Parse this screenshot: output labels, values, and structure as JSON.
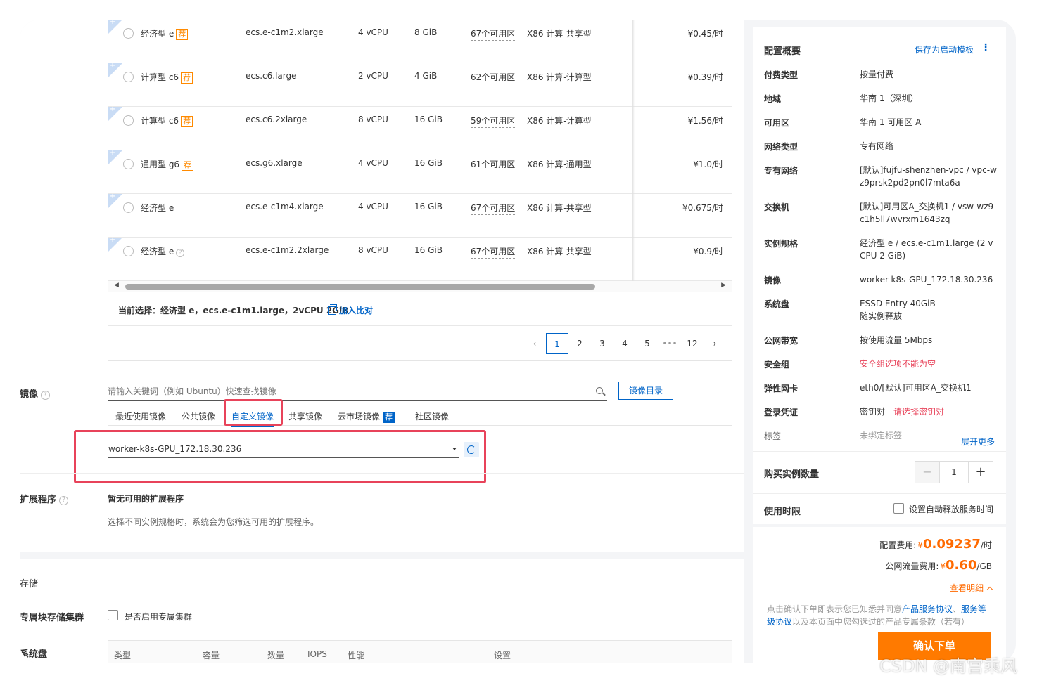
{
  "spec_rows": [
    {
      "family": "经济型 e",
      "badge": "荐",
      "code": "ecs.e-c1m2.xlarge",
      "vcpu": "4 vCPU",
      "mem": "8 GiB",
      "zones": "67个可用区",
      "arch": "X86 计算-共享型",
      "price": "¥0.45",
      "unit": "/时"
    },
    {
      "family": "计算型 c6",
      "badge": "荐",
      "code": "ecs.c6.large",
      "vcpu": "2 vCPU",
      "mem": "4 GiB",
      "zones": "62个可用区",
      "arch": "X86 计算-计算型",
      "price": "¥0.39",
      "unit": "/时"
    },
    {
      "family": "计算型 c6",
      "badge": "荐",
      "code": "ecs.c6.2xlarge",
      "vcpu": "8 vCPU",
      "mem": "16 GiB",
      "zones": "59个可用区",
      "arch": "X86 计算-计算型",
      "price": "¥1.56",
      "unit": "/时"
    },
    {
      "family": "通用型 g6",
      "badge": "荐",
      "code": "ecs.g6.xlarge",
      "vcpu": "4 vCPU",
      "mem": "16 GiB",
      "zones": "61个可用区",
      "arch": "X86 计算-通用型",
      "price": "¥1.0",
      "unit": "/时"
    },
    {
      "family": "经济型 e",
      "badge": "",
      "code": "ecs.e-c1m4.xlarge",
      "vcpu": "4 vCPU",
      "mem": "16 GiB",
      "zones": "67个可用区",
      "arch": "X86 计算-共享型",
      "price": "¥0.675",
      "unit": "/时"
    },
    {
      "family": "经济型 e",
      "badge": "",
      "code": "ecs.e-c1m2.2xlarge",
      "vcpu": "8 vCPU",
      "mem": "16 GiB",
      "zones": "67个可用区",
      "arch": "X86 计算-共享型",
      "price": "¥0.9",
      "unit": "/时"
    }
  ],
  "selection": {
    "label": "当前选择：",
    "value": "经济型 e，ecs.e-c1m1.large，2vCPU 2GiB",
    "compare": "加入比对"
  },
  "pagination": {
    "prev": "‹",
    "pages": [
      "1",
      "2",
      "3",
      "4",
      "5"
    ],
    "ellipsis": "•••",
    "last": "12",
    "next": "›"
  },
  "image": {
    "label": "镜像",
    "search_placeholder": "请输入关键词（例如 Ubuntu）快速查找镜像",
    "catalog_button": "镜像目录",
    "tabs": [
      "最近使用镜像",
      "公共镜像",
      "自定义镜像",
      "共享镜像",
      "云市场镜像",
      "社区镜像"
    ],
    "market_badge": "荐",
    "selected": "worker-k8s-GPU_172.18.30.236"
  },
  "extension": {
    "label": "扩展程序",
    "title": "暂无可用的扩展程序",
    "desc": "选择不同实例规格时，系统会为您筛选可用的扩展程序。"
  },
  "storage": {
    "label": "存储",
    "dedicated_cluster_label": "专属块存储集群",
    "dedicated_cluster_checkbox": "是否启用专属集群",
    "system_disk_label": "系统盘",
    "columns": [
      "类型",
      "容量",
      "数量",
      "IOPS",
      "性能",
      "设置"
    ]
  },
  "summary": {
    "title": "配置概要",
    "save_template": "保存为启动模板",
    "items": [
      {
        "key": "付费类型",
        "value": "按量付费"
      },
      {
        "key": "地域",
        "value": "华南 1（深圳）"
      },
      {
        "key": "可用区",
        "value": "华南 1 可用区 A"
      },
      {
        "key": "网络类型",
        "value": "专有网络"
      },
      {
        "key": "专有网络",
        "value": "[默认]fujfu-shenzhen-vpc / vpc-wz9prsk2pd2pn0l7mta6a"
      },
      {
        "key": "交换机",
        "value": "[默认]可用区A_交换机1 / vsw-wz9c1h5ll7wvrxm1643zq"
      },
      {
        "key": "实例规格",
        "value": "经济型 e / ecs.e-c1m1.large (2 vCPU 2 GiB)"
      },
      {
        "key": "镜像",
        "value": "worker-k8s-GPU_172.18.30.236"
      },
      {
        "key": "系统盘",
        "value": "ESSD Entry 40GiB",
        "value2": "随实例释放"
      },
      {
        "key": "公网带宽",
        "value": "按使用流量 5Mbps"
      },
      {
        "key": "安全组",
        "value": "安全组选项不能为空"
      },
      {
        "key": "弹性网卡",
        "value": "eth0/[默认]可用区A_交换机1"
      },
      {
        "key": "登录凭证",
        "value": "密钥对 - ",
        "link": "请选择密钥对"
      },
      {
        "key": "标签",
        "value": "未绑定标签"
      }
    ],
    "expand_more": "展开更多",
    "quantity_label": "购买实例数量",
    "quantity": "1",
    "duration_label": "使用时限",
    "auto_release": "设置自动释放服务时间",
    "config_fee_label": "配置费用:",
    "config_fee_currency": "¥",
    "config_fee": "0.09237",
    "config_fee_unit": "/时",
    "traffic_fee_label": "公网流量费用:",
    "traffic_fee_currency": "¥",
    "traffic_fee": "0.60",
    "traffic_fee_unit": "/GB",
    "view_detail": "查看明细",
    "agreement_pre": "点击确认下单即表示您已知悉并同意",
    "agreement_link1": "产品服务协议",
    "agreement_sep": "、",
    "agreement_link2": "服务等级协议",
    "agreement_post": "以及本页面中您勾选过的产品专属条款（若有）",
    "confirm": "确认下单"
  },
  "watermark": "CSDN @南宫乘风",
  "colors": {
    "accent": "#0064c8",
    "price": "#ff6a00",
    "highlight": "#e8435a",
    "confirm": "#ff7a00"
  }
}
